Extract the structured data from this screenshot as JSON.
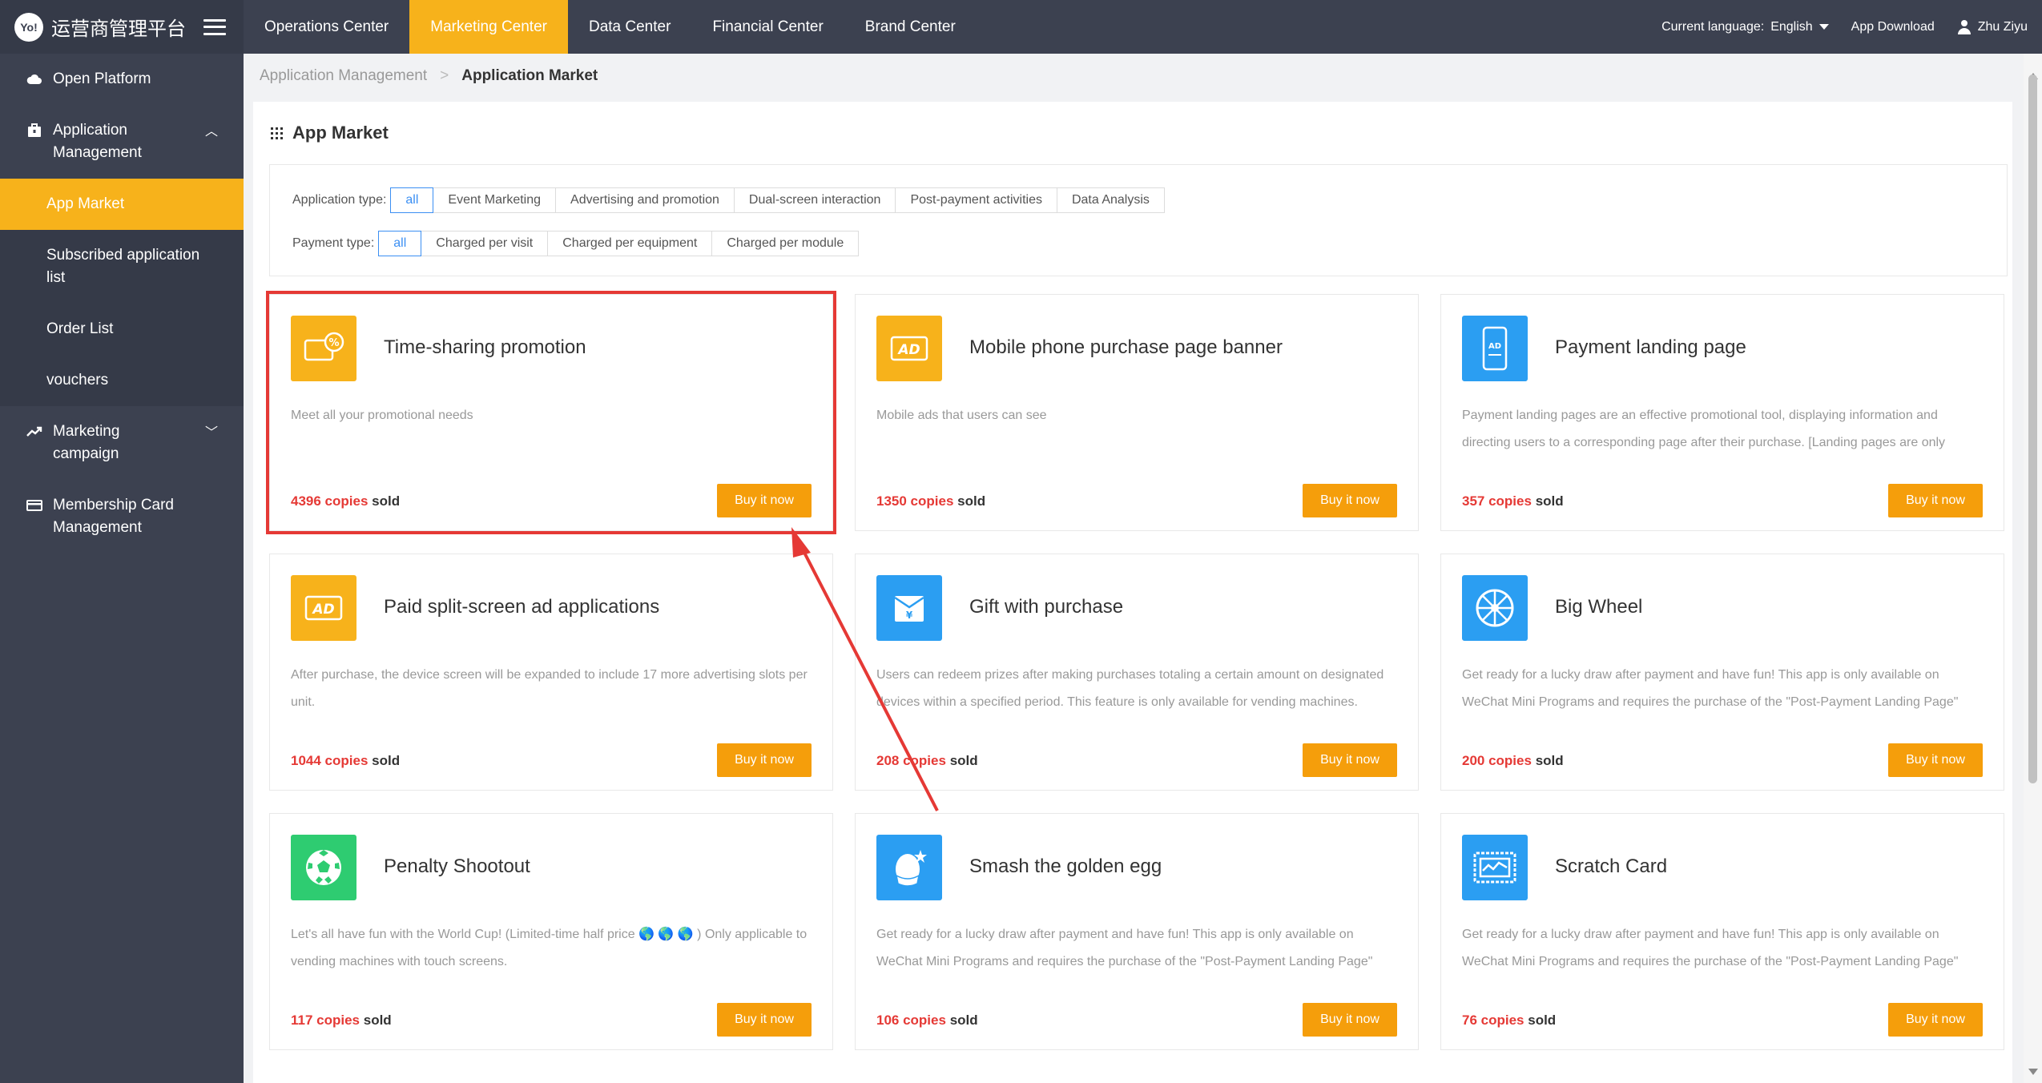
{
  "app": {
    "logo_text": "运营商管理平台",
    "logo_badge": "Yo!"
  },
  "topnav": [
    {
      "label": "Operations Center",
      "active": false
    },
    {
      "label": "Marketing Center",
      "active": true
    },
    {
      "label": "Data Center",
      "active": false
    },
    {
      "label": "Financial Center",
      "active": false
    },
    {
      "label": "Brand Center",
      "active": false
    }
  ],
  "topright": {
    "language_label": "Current language:",
    "language_value": "English",
    "app_download": "App Download",
    "user_name": "Zhu Ziyu"
  },
  "sidebar": {
    "open_platform": "Open Platform",
    "application_management": "Application Management",
    "sub_items": [
      "App Market",
      "Subscribed application list",
      "Order List",
      "vouchers"
    ],
    "marketing_campaign": "Marketing campaign",
    "membership_card": "Membership Card Management"
  },
  "breadcrumb": {
    "parent": "Application Management",
    "separator": ">",
    "current": "Application Market"
  },
  "panel": {
    "title": "App Market"
  },
  "filters": {
    "application_type": {
      "label": "Application type:",
      "options": [
        "all",
        "Event Marketing",
        "Advertising and promotion",
        "Dual-screen interaction",
        "Post-payment activities",
        "Data Analysis"
      ],
      "selected": "all"
    },
    "payment_type": {
      "label": "Payment type:",
      "options": [
        "all",
        "Charged per visit",
        "Charged per equipment",
        "Charged per module"
      ],
      "selected": "all"
    }
  },
  "cards": [
    {
      "title": "Time-sharing promotion",
      "desc": "Meet all your promotional needs",
      "sold": "4396 copies",
      "sold_suffix": "sold",
      "button": "Buy it now",
      "icon": "discount-icon",
      "color": "#f7b21b",
      "highlighted": true
    },
    {
      "title": "Mobile phone purchase page banner",
      "desc": "Mobile ads that users can see",
      "sold": "1350 copies",
      "sold_suffix": "sold",
      "button": "Buy it now",
      "icon": "ad-icon",
      "color": "#f7b21b"
    },
    {
      "title": "Payment landing page",
      "desc": "Payment landing pages are an effective promotional tool, displaying information and directing users to a corresponding page after their purchase. [Landing pages are only",
      "sold": "357 copies",
      "sold_suffix": "sold",
      "button": "Buy it now",
      "icon": "phone-ad-icon",
      "color": "#2b9ef2"
    },
    {
      "title": "Paid split-screen ad applications",
      "desc": "After purchase, the device screen will be expanded to include 17 more advertising slots per unit.",
      "sold": "1044 copies",
      "sold_suffix": "sold",
      "button": "Buy it now",
      "icon": "ad-icon",
      "color": "#f7b21b"
    },
    {
      "title": "Gift with purchase",
      "desc": "Users can redeem prizes after making purchases totaling a certain amount on designated devices within a specified period. This feature is only available for vending machines.",
      "sold": "208 copies",
      "sold_suffix": "sold",
      "button": "Buy it now",
      "icon": "gift-envelope-icon",
      "color": "#2b9ef2"
    },
    {
      "title": "Big Wheel",
      "desc": "Get ready for a lucky draw after payment and have fun! This app is only available on WeChat Mini Programs and requires the purchase of the \"Post-Payment Landing Page\"",
      "sold": "200 copies",
      "sold_suffix": "sold",
      "button": "Buy it now",
      "icon": "wheel-icon",
      "color": "#2b9ef2"
    },
    {
      "title": "Penalty Shootout",
      "desc": "Let's all have fun with the World Cup! (Limited-time half price 🌎 🌎 🌎 ) Only applicable to vending machines with touch screens.",
      "sold": "117 copies",
      "sold_suffix": "sold",
      "button": "Buy it now",
      "icon": "soccer-ball-icon",
      "color": "#2ecc71"
    },
    {
      "title": "Smash the golden egg",
      "desc": "Get ready for a lucky draw after payment and have fun! This app is only available on WeChat Mini Programs and requires the purchase of the \"Post-Payment Landing Page\"",
      "sold": "106 copies",
      "sold_suffix": "sold",
      "button": "Buy it now",
      "icon": "egg-icon",
      "color": "#2b9ef2"
    },
    {
      "title": "Scratch Card",
      "desc": "Get ready for a lucky draw after payment and have fun! This app is only available on WeChat Mini Programs and requires the purchase of the \"Post-Payment Landing Page\"",
      "sold": "76 copies",
      "sold_suffix": "sold",
      "button": "Buy it now",
      "icon": "scratch-card-icon",
      "color": "#2b9ef2"
    }
  ],
  "colors": {
    "accent": "#f7b21b",
    "button": "#f59e0b",
    "highlight": "#e53935",
    "chip_active": "#3b8ff3",
    "nav_bg": "#3c4150"
  }
}
